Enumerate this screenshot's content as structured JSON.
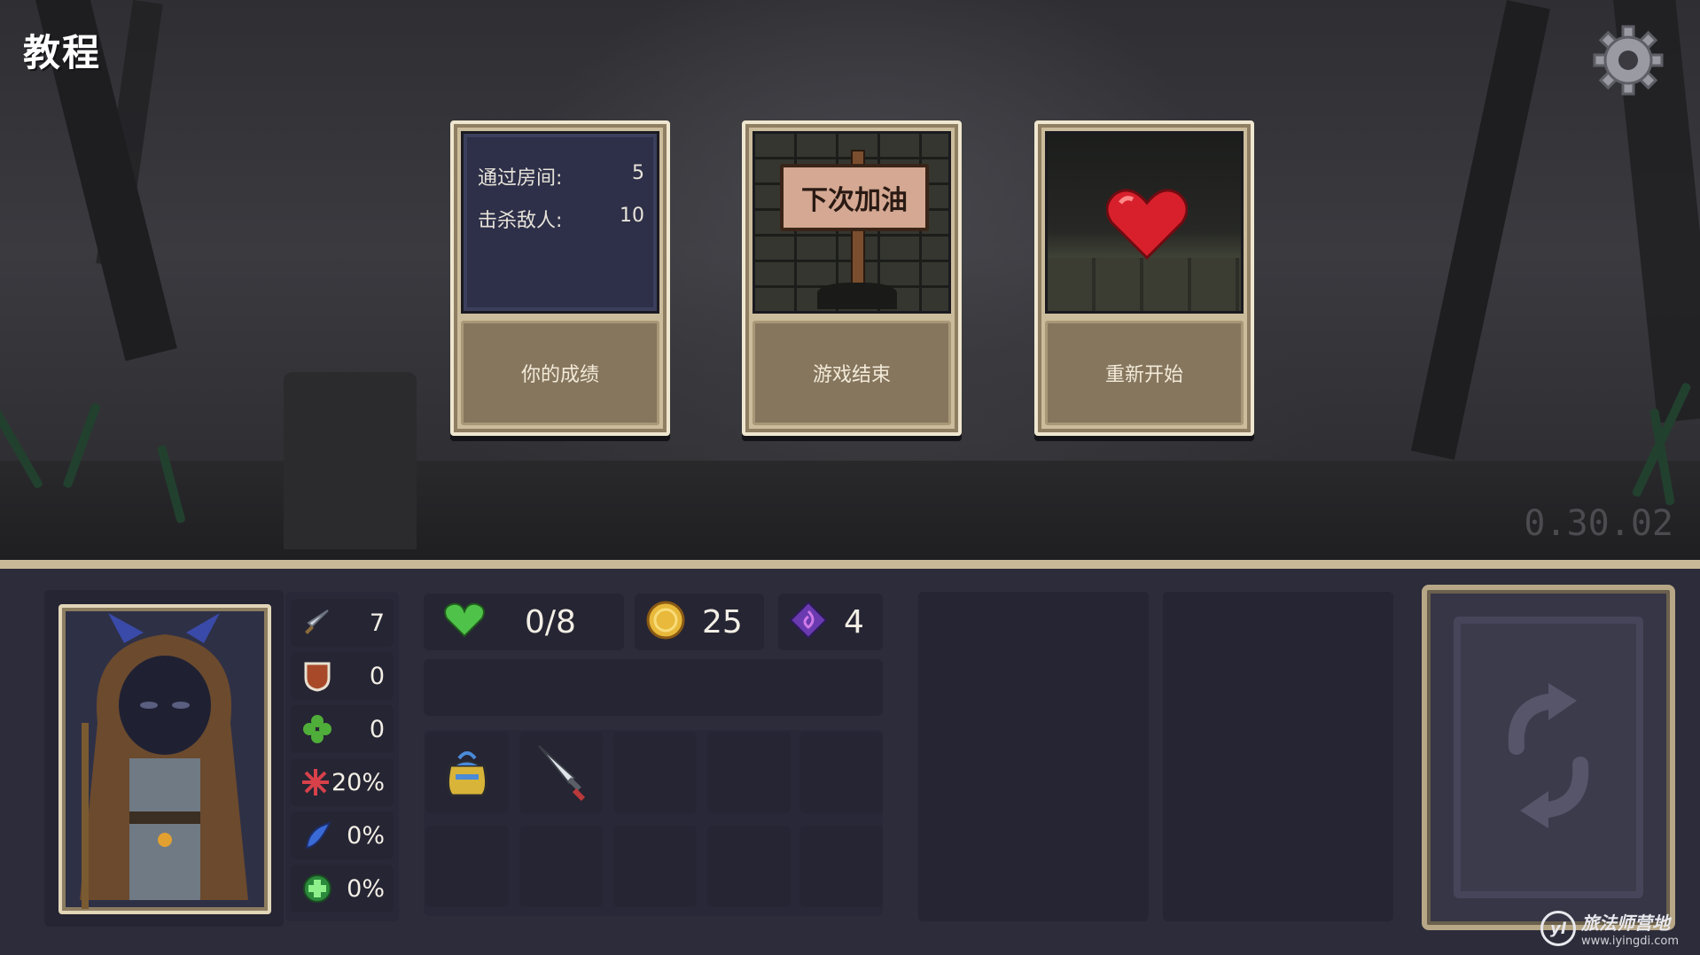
{
  "header": {
    "title": "教程",
    "version": "0.30.02",
    "settings_icon": "gear-icon"
  },
  "cards": {
    "stats": {
      "rooms_label": "通过房间:",
      "rooms_value": "5",
      "kills_label": "击杀敌人:",
      "kills_value": "10",
      "label": "你的成绩"
    },
    "game_over": {
      "sign_text": "下次加油",
      "label": "游戏结束"
    },
    "restart": {
      "label": "重新开始",
      "icon": "heart-icon"
    }
  },
  "hud": {
    "stats": [
      {
        "icon": "sword-icon",
        "value": "7"
      },
      {
        "icon": "shield-icon",
        "value": "0"
      },
      {
        "icon": "clover-icon",
        "value": "0"
      },
      {
        "icon": "crit-icon",
        "value": "20%"
      },
      {
        "icon": "feather-icon",
        "value": "0%"
      },
      {
        "icon": "heal-plus-icon",
        "value": "0%"
      }
    ],
    "health": {
      "value": "0/8",
      "icon": "heart-icon",
      "color": "#4fc24a"
    },
    "coins": {
      "value": "25",
      "icon": "coin-icon",
      "color": "#e8b93a"
    },
    "gems": {
      "value": "4",
      "icon": "gem-icon",
      "color": "#8b4fd0"
    },
    "inventory": [
      {
        "icon": "bag-icon"
      },
      {
        "icon": "dagger-icon"
      }
    ],
    "reroll_icon": "refresh-icon"
  },
  "watermark": {
    "logo": "yl",
    "name": "旅法师营地",
    "url": "www.iyingdi.com"
  }
}
